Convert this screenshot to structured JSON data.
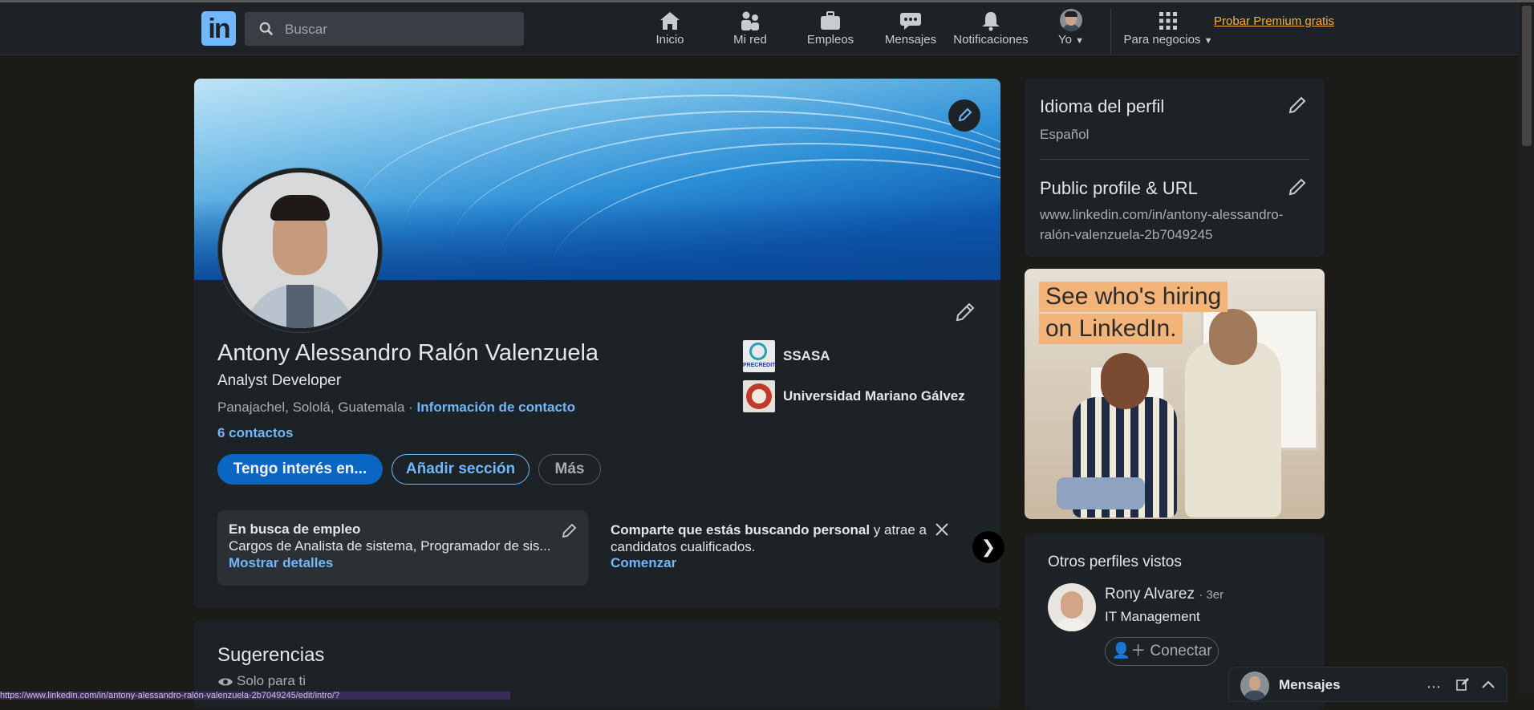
{
  "nav": {
    "search_placeholder": "Buscar",
    "items": [
      {
        "label": "Inicio",
        "icon": "home-icon"
      },
      {
        "label": "Mi red",
        "icon": "network-icon"
      },
      {
        "label": "Empleos",
        "icon": "briefcase-icon"
      },
      {
        "label": "Mensajes",
        "icon": "messaging-icon"
      },
      {
        "label": "Notificaciones",
        "icon": "bell-icon"
      }
    ],
    "me_label": "Yo",
    "business_label": "Para negocios",
    "premium_label": "Probar Premium gratis"
  },
  "profile": {
    "name": "Antony Alessandro Ralón Valenzuela",
    "headline": "Analyst Developer",
    "location": "Panajachel, Sololá, Guatemala",
    "location_sep": " · ",
    "contact_link": "Información de contacto",
    "connections": "6 contactos",
    "orgs": [
      {
        "name": "SSASA",
        "logo_text": "PRECREDIT"
      },
      {
        "name": "Universidad Mariano Gálvez"
      }
    ],
    "buttons": {
      "open_to": "Tengo interés en...",
      "add_section": "Añadir sección",
      "more": "Más"
    },
    "open_to_work": {
      "title": "En busca de empleo",
      "subtitle": "Cargos de Analista de sistema, Programador de sis...",
      "link": "Mostrar detalles"
    },
    "hiring": {
      "bold": "Comparte que estás buscando personal",
      "rest": " y atrae a candidatos cualificados.",
      "link": "Comenzar"
    }
  },
  "suggestions": {
    "title": "Sugerencias",
    "subtitle": "Solo para ti"
  },
  "sidebar": {
    "language_title": "Idioma del perfil",
    "language_value": "Español",
    "public_title": "Public profile & URL",
    "public_url_1": "www.linkedin.com/in/antony-alessandro-",
    "public_url_2": "ralón-valenzuela-2b7049245"
  },
  "ad": {
    "line1": "See who's hiring",
    "line2": "on LinkedIn."
  },
  "others": {
    "title": "Otros perfiles vistos",
    "person_name": "Rony Alvarez",
    "person_degree": "· 3er",
    "person_headline": "IT Management",
    "connect_label": "Conectar"
  },
  "messaging": {
    "label": "Mensajes"
  },
  "status_url": "https://www.linkedin.com/in/antony-alessandro-ralón-valenzuela-2b7049245/edit/intro/?",
  "colors": {
    "accent": "#71b7fb",
    "primary_button": "#0a66c2",
    "premium": "#f5b042",
    "background": "#1b1b18",
    "card": "#1d2226"
  }
}
